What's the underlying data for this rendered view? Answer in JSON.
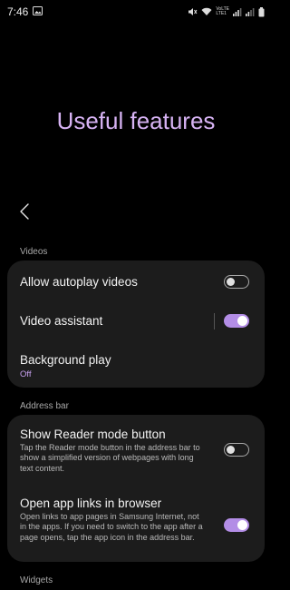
{
  "status_bar": {
    "time": "7:46",
    "network_label": "VoLTE\nLTE1"
  },
  "page": {
    "title": "Useful features",
    "back_icon": "chevron-left-icon"
  },
  "sections": {
    "videos": {
      "header": "Videos",
      "items": {
        "autoplay": {
          "title": "Allow autoplay videos",
          "toggle": "off"
        },
        "assistant": {
          "title": "Video assistant",
          "toggle": "on"
        },
        "background": {
          "title": "Background play",
          "value": "Off"
        }
      }
    },
    "address_bar": {
      "header": "Address bar",
      "items": {
        "reader": {
          "title": "Show Reader mode button",
          "subtitle": "Tap the Reader mode button in the address bar to show a simplified version of webpages with long text content.",
          "toggle": "off"
        },
        "app_links": {
          "title": "Open app links in browser",
          "subtitle": "Open links to app pages in Samsung Internet, not in the apps. If you need to switch to the app after a page opens, tap the app icon in the address bar.",
          "toggle": "on"
        }
      }
    },
    "widgets": {
      "header": "Widgets"
    }
  },
  "colors": {
    "accent": "#d7b3f4",
    "toggle_on": "#b38de6",
    "card_bg": "#1c1c1c"
  }
}
